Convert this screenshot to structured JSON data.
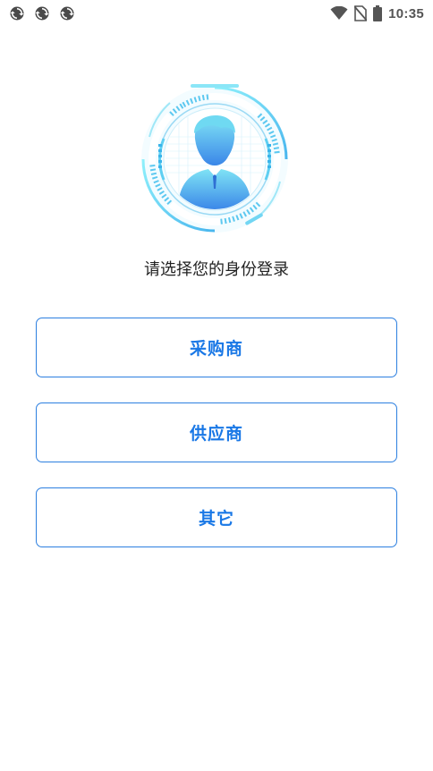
{
  "status_bar": {
    "time": "10:35",
    "notification_icons": [
      "sync-icon",
      "sync-icon",
      "sync-icon"
    ],
    "system_icons": [
      "wifi-icon",
      "no-sim-icon",
      "battery-icon"
    ]
  },
  "login": {
    "avatar_icon": "face-scan-avatar-icon",
    "prompt": "请选择您的身份登录",
    "roles": [
      {
        "label": "采购商"
      },
      {
        "label": "供应商"
      },
      {
        "label": "其它"
      }
    ]
  },
  "colors": {
    "accent": "#1a78e6",
    "border": "#2c7fe0",
    "avatar_light": "#7fe3f5",
    "avatar_dark": "#3a86e8"
  }
}
